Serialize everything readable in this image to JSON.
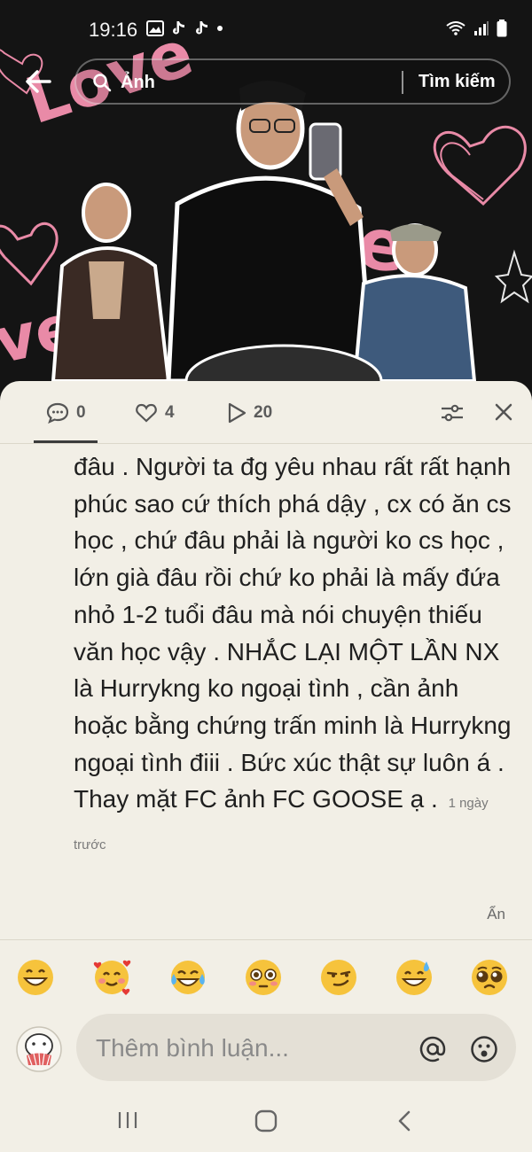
{
  "status_bar": {
    "time": "19:16",
    "icons_left": [
      "gallery-icon",
      "tiktok-icon",
      "tiktok-icon",
      "dot-icon"
    ],
    "icons_right": [
      "wifi-icon",
      "signal-icon",
      "battery-icon"
    ]
  },
  "search": {
    "query": "Ảnh",
    "button_label": "Tìm kiếm"
  },
  "stats": {
    "comments": "0",
    "likes": "4",
    "plays": "20"
  },
  "comment": {
    "text": "đâu . Người ta đg yêu nhau rất rất hạnh phúc sao cứ thích phá dậy , cx có ăn cs học , chứ đâu phải là người ko cs học , lớn già đâu rồi chứ ko phải là mấy đứa nhỏ 1-2 tuổi đâu mà nói chuyện thiếu văn học vậy . NHẮC LẠI MỘT LẦN NX là Hurrykng ko ngoại tình , cần ảnh hoặc bằng chứng trấn minh là Hurrykng ngoại tình điii . Bức xúc thật sự luôn á . Thay mặt FC ảnh FC GOOSE ạ .",
    "time": "1 ngày trước",
    "hide_label": "Ẩn"
  },
  "emojis": [
    "grinning",
    "smiling-hearts",
    "tears-of-joy",
    "flushed",
    "smirk",
    "sweat-smile",
    "pleading"
  ],
  "input": {
    "placeholder": "Thêm bình luận..."
  },
  "colors": {
    "sheet_bg": "#f2efe6",
    "photo_bg": "#131313",
    "emoji_yellow": "#f6c33c",
    "accent_pink": "#e88aa8"
  }
}
